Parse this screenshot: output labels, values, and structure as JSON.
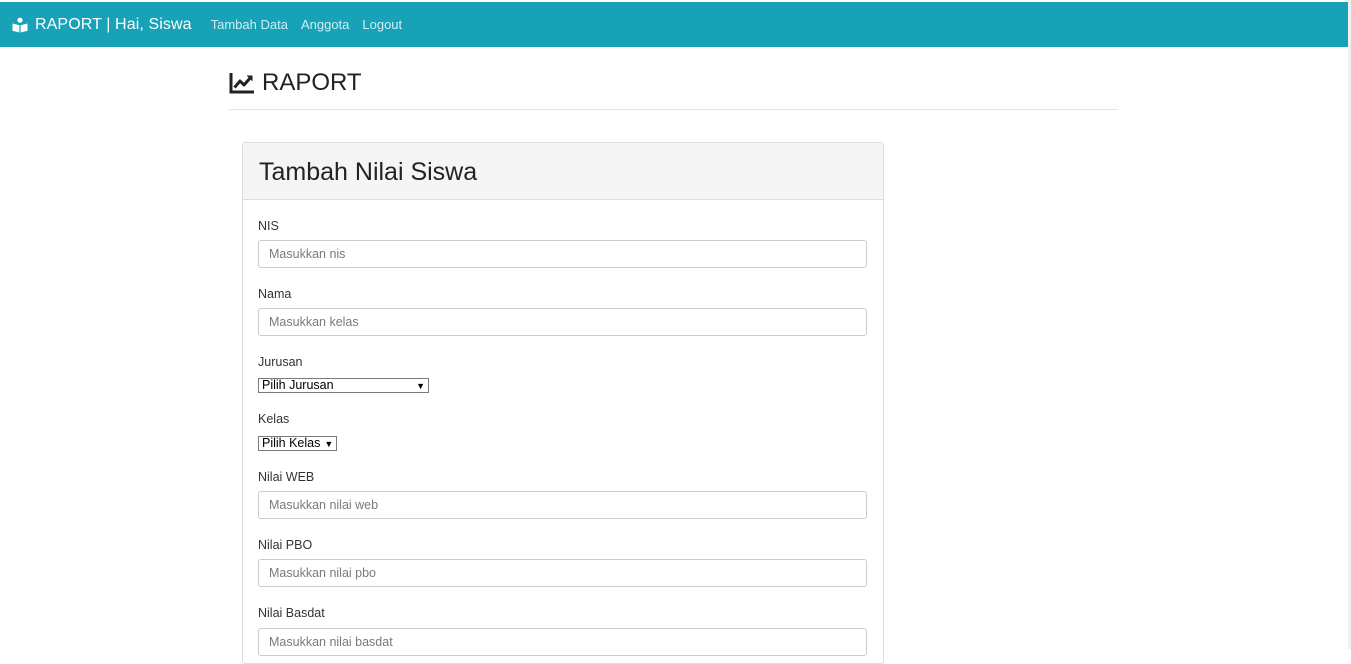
{
  "navbar": {
    "brand_icon": "reader-icon",
    "brand_text": "RAPORT | Hai, Siswa",
    "links": [
      "Tambah Data",
      "Anggota",
      "Logout"
    ]
  },
  "header": {
    "icon": "chart-line-icon",
    "title": "RAPORT"
  },
  "form": {
    "title": "Tambah Nilai Siswa",
    "nis": {
      "label": "NIS",
      "placeholder": "Masukkan nis"
    },
    "nama": {
      "label": "Nama",
      "placeholder": "Masukkan kelas"
    },
    "jurusan": {
      "label": "Jurusan",
      "selected": "Pilih Jurusan"
    },
    "kelas": {
      "label": "Kelas",
      "selected": "Pilih Kelas"
    },
    "nilai_web": {
      "label": "Nilai WEB",
      "placeholder": "Masukkan nilai web"
    },
    "nilai_pbo": {
      "label": "Nilai PBO",
      "placeholder": "Masukkan nilai pbo"
    },
    "nilai_basdat": {
      "label": "Nilai Basdat",
      "placeholder": "Masukkan nilai basdat"
    }
  },
  "colors": {
    "navbar": "#17a2b8",
    "nav_link": "#cfeef3",
    "panel_heading": "#f5f5f5"
  }
}
